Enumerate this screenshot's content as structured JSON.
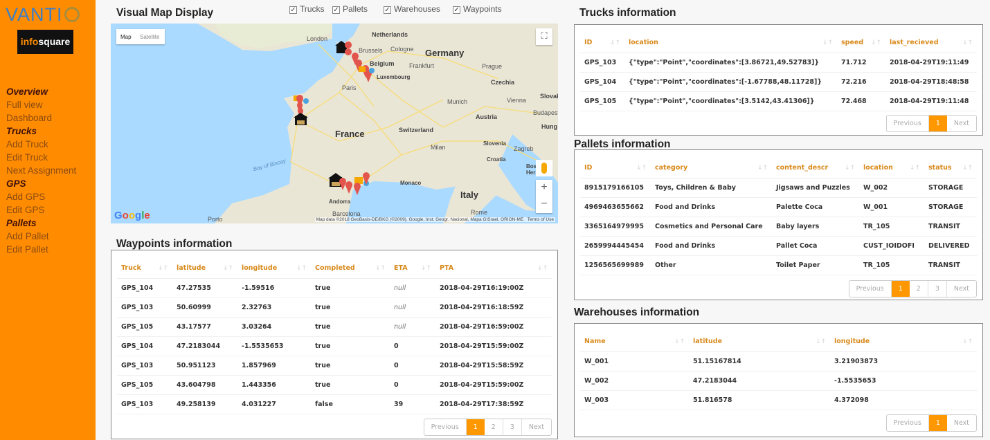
{
  "sidebar": {
    "brand": "VANTI",
    "partner_logo": {
      "pre": "info",
      "post": "square"
    },
    "nav": [
      {
        "label": "Overview",
        "type": "section"
      },
      {
        "label": "Full view",
        "type": "link"
      },
      {
        "label": "Dashboard",
        "type": "link"
      },
      {
        "label": "Trucks",
        "type": "section"
      },
      {
        "label": "Add Truck",
        "type": "link"
      },
      {
        "label": "Edit Truck",
        "type": "link"
      },
      {
        "label": "Next Assignment",
        "type": "link"
      },
      {
        "label": "GPS",
        "type": "section"
      },
      {
        "label": "Add GPS",
        "type": "link"
      },
      {
        "label": "Edit GPS",
        "type": "link"
      },
      {
        "label": "Pallets",
        "type": "section"
      },
      {
        "label": "Add Pallet",
        "type": "link"
      },
      {
        "label": "Edit Pallet",
        "type": "link"
      }
    ]
  },
  "map_section": {
    "title": "Visual Map Display",
    "filters": [
      {
        "label": "Trucks",
        "checked": true
      },
      {
        "label": "Pallets",
        "checked": true
      },
      {
        "label": "Warehouses",
        "checked": true
      },
      {
        "label": "Waypoints",
        "checked": true
      }
    ],
    "map": {
      "type_buttons": [
        "Map",
        "Satellite"
      ],
      "google": "Google",
      "attribution": "Map data ©2018 GeoBasis-DE/BKG (©2009), Google, Inst. Geogr. Nacional, Mapa GISrael, ORION-ME",
      "terms": "Terms of Use",
      "zoom_in": "+",
      "zoom_out": "−",
      "fullscreen": "⛶",
      "labels": {
        "countries": [
          "Netherlands",
          "Belgium",
          "Germany",
          "France",
          "Italy",
          "Czechia",
          "Luxembourg",
          "Switzerland",
          "Austria",
          "Slovenia",
          "Croatia",
          "Andorra",
          "Monaco",
          "Bosnia Herzeg",
          "Slovak",
          "Hung"
        ],
        "cities": [
          "London",
          "Brussels",
          "Cologne",
          "Frankfurt",
          "Prague",
          "Paris",
          "Munich",
          "Vienna",
          "Budapest",
          "Milan",
          "Zagreb",
          "Rome",
          "Barcelona",
          "Porto"
        ],
        "sea": "Bay of Biscay"
      }
    }
  },
  "waypoints": {
    "title": "Waypoints information",
    "columns": [
      "Truck",
      "latitude",
      "longitude",
      "Completed",
      "ETA",
      "PTA"
    ],
    "rows": [
      [
        "GPS_104",
        "47.27535",
        "-1.59516",
        "true",
        "null",
        "2018-04-29T16:19:00Z"
      ],
      [
        "GPS_103",
        "50.60999",
        "2.32763",
        "true",
        "null",
        "2018-04-29T16:18:59Z"
      ],
      [
        "GPS_105",
        "43.17577",
        "3.03264",
        "true",
        "null",
        "2018-04-29T16:59:00Z"
      ],
      [
        "GPS_104",
        "47.2183044",
        "-1.5535653",
        "true",
        "0",
        "2018-04-29T15:59:00Z"
      ],
      [
        "GPS_103",
        "50.951123",
        "1.857969",
        "true",
        "0",
        "2018-04-29T15:58:59Z"
      ],
      [
        "GPS_105",
        "43.604798",
        "1.443356",
        "true",
        "0",
        "2018-04-29T15:59:00Z"
      ],
      [
        "GPS_103",
        "49.258139",
        "4.031227",
        "false",
        "39",
        "2018-04-29T17:38:59Z"
      ]
    ],
    "pager": [
      "Previous",
      "1",
      "2",
      "3",
      "Next"
    ],
    "active_page": "1"
  },
  "trucks": {
    "title": "Trucks information",
    "columns": [
      "ID",
      "location",
      "speed",
      "last_recieved"
    ],
    "rows": [
      [
        "GPS_103",
        "{\"type\":\"Point\",\"coordinates\":[3.86721,49.52783]}",
        "71.712",
        "2018-04-29T19:11:49"
      ],
      [
        "GPS_104",
        "{\"type\":\"Point\",\"coordinates\":[-1.67788,48.11728]}",
        "72.216",
        "2018-04-29T18:48:58"
      ],
      [
        "GPS_105",
        "{\"type\":\"Point\",\"coordinates\":[3.5142,43.41306]}",
        "72.468",
        "2018-04-29T19:11:48"
      ]
    ],
    "pager": [
      "Previous",
      "1",
      "Next"
    ],
    "active_page": "1"
  },
  "pallets": {
    "title": "Pallets information",
    "columns": [
      "ID",
      "category",
      "content_descr",
      "location",
      "status"
    ],
    "rows": [
      [
        "8915179166105",
        "Toys, Children & Baby",
        "Jigsaws and Puzzles",
        "W_002",
        "STORAGE"
      ],
      [
        "4969463655662",
        "Food and Drinks",
        "Palette Coca",
        "W_001",
        "STORAGE"
      ],
      [
        "3365164979995",
        "Cosmetics and Personal Care",
        "Baby layers",
        "TR_105",
        "TRANSIT"
      ],
      [
        "2659994445454",
        "Food and Drinks",
        "Pallet Coca",
        "CUST_IOIDOFI",
        "DELIVERED"
      ],
      [
        "1256565699989",
        "Other",
        "Toilet Paper",
        "TR_105",
        "TRANSIT"
      ]
    ],
    "pager": [
      "Previous",
      "1",
      "2",
      "3",
      "Next"
    ],
    "active_page": "1"
  },
  "warehouses": {
    "title": "Warehouses information",
    "columns": [
      "Name",
      "latitude",
      "longitude"
    ],
    "rows": [
      [
        "W_001",
        "51.15167814",
        "3.21903873"
      ],
      [
        "W_002",
        "47.2183044",
        "-1.5535653"
      ],
      [
        "W_003",
        "51.816578",
        "4.372098"
      ]
    ],
    "pager": [
      "Previous",
      "1",
      "Next"
    ],
    "active_page": "1"
  },
  "colors": {
    "sidebar": "#ff8c00",
    "accent": "#ff9800",
    "header_text": "#d98a1c"
  }
}
